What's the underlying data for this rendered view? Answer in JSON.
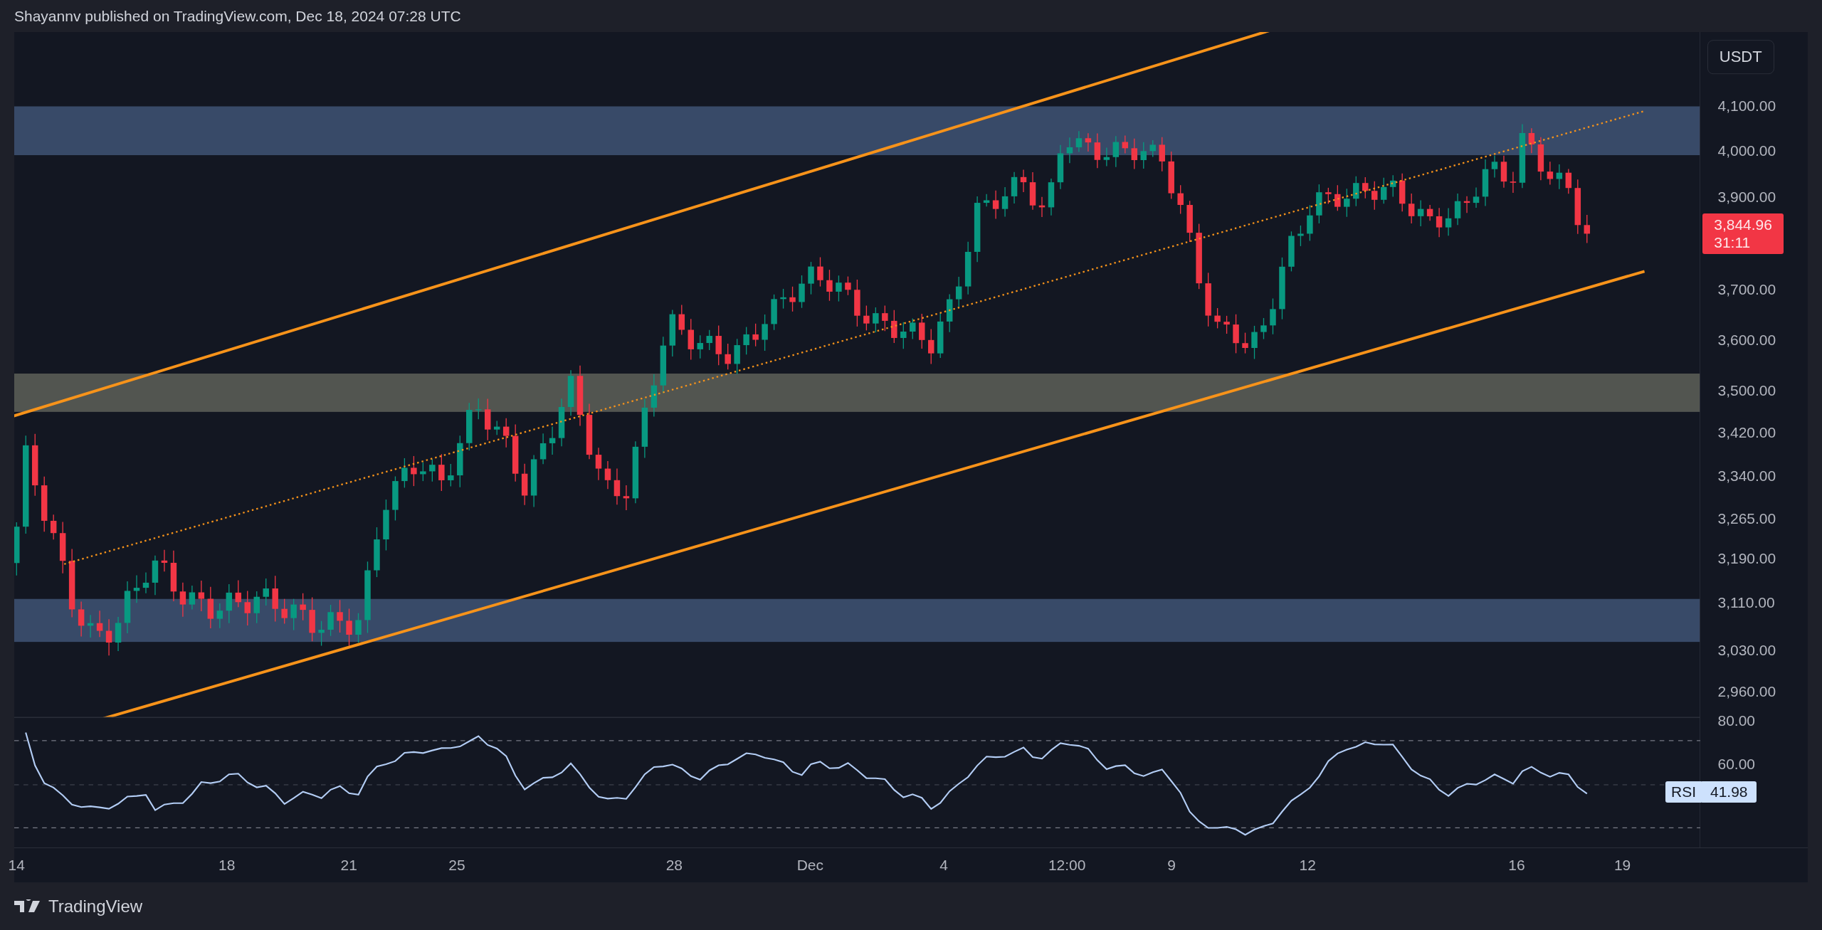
{
  "header": {
    "text": "Shayannv published on TradingView.com, Dec 18, 2024 07:28 UTC"
  },
  "price_axis": {
    "currency": "USDT",
    "labels": [
      "4,100.00",
      "4,000.00",
      "3,900.00",
      "3,700.00",
      "3,600.00",
      "3,500.00",
      "3,420.00",
      "3,340.00",
      "3,265.00",
      "3,190.00",
      "3,110.00",
      "3,030.00",
      "2,960.00"
    ],
    "last_price": "3,844.96",
    "countdown": "31:11"
  },
  "rsi": {
    "labels": [
      "80.00",
      "60.00"
    ],
    "name": "RSI",
    "value": "41.98"
  },
  "time_axis": {
    "labels": [
      "14",
      "18",
      "21",
      "25",
      "28",
      "Dec",
      "4",
      "12:00",
      "9",
      "12",
      "16",
      "19"
    ]
  },
  "footer": {
    "brand": "TradingView"
  }
}
